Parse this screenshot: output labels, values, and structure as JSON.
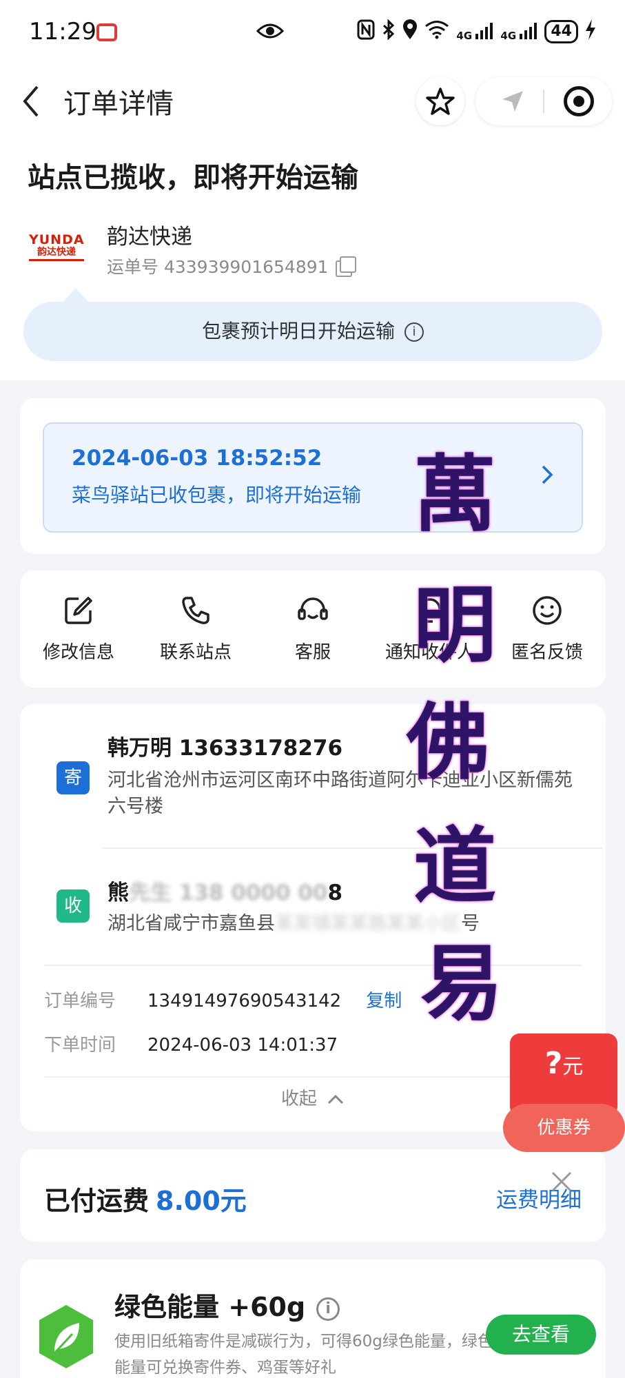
{
  "status_bar": {
    "time": "11:29",
    "signal1": "4G",
    "signal2": "4G",
    "battery": "44"
  },
  "nav": {
    "title": "订单详情"
  },
  "header": {
    "status_title": "站点已揽收，即将开始运输",
    "logo_text": "YUNDA",
    "logo_sub": "韵达快递",
    "carrier": "韵达快递",
    "waybill": "运单号 433939901654891",
    "bubble": "包裹预计明日开始运输"
  },
  "latest": {
    "datetime": "2024-06-03 18:52:52",
    "desc": "菜鸟驿站已收包裹，即将开始运输"
  },
  "actions": [
    {
      "label": "修改信息",
      "icon": "edit-icon"
    },
    {
      "label": "联系站点",
      "icon": "phone-icon"
    },
    {
      "label": "客服",
      "icon": "headset-icon"
    },
    {
      "label": "通知收件人",
      "icon": "bell-icon"
    },
    {
      "label": "匿名反馈",
      "icon": "smile-icon"
    }
  ],
  "sender": {
    "tag": "寄",
    "name": "韩万明 13633178276",
    "address": "河北省沧州市运河区南环中路街道阿尔卡迪亚小区新儒苑六号楼"
  },
  "receiver": {
    "tag": "收",
    "name": "熊",
    "phone_end": "8",
    "address_visible": "湖北省咸宁市嘉鱼县",
    "address_end": "号"
  },
  "order": {
    "number_label": "订单编号",
    "number": "13491497690543142",
    "copy": "复制",
    "time_label": "下单时间",
    "time": "2024-06-03 14:01:37",
    "collapse": "收起"
  },
  "fee": {
    "label": "已付运费",
    "value": "8.00元",
    "detail": "运费明细"
  },
  "green": {
    "title": "绿色能量 +60g",
    "desc": "使用旧纸箱寄件是减碳行为，可得60g绿色能量，绿色能量可兑换寄件券、鸡蛋等好礼",
    "button": "去查看"
  },
  "coupon": {
    "amount": "?",
    "unit": "元",
    "label": "优惠券"
  },
  "watermark": [
    "萬",
    "明",
    "佛",
    "道",
    "易"
  ],
  "colors": {
    "accent": "#1b6fd6",
    "green": "#23b14d",
    "coupon": "#ee3b3b"
  }
}
